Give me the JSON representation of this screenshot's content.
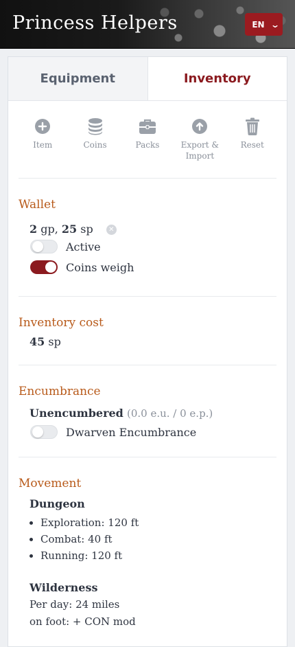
{
  "header": {
    "title": "Princess Helpers",
    "lang": "EN"
  },
  "tabs": [
    {
      "label": "Equipment",
      "active": false
    },
    {
      "label": "Inventory",
      "active": true
    }
  ],
  "toolbar": [
    {
      "label": "Item",
      "icon": "plus-circle-icon"
    },
    {
      "label": "Coins",
      "icon": "coins-icon"
    },
    {
      "label": "Packs",
      "icon": "backpack-icon"
    },
    {
      "label": "Export &\nImport",
      "icon": "upload-circle-icon"
    },
    {
      "label": "Reset",
      "icon": "trash-icon"
    }
  ],
  "wallet": {
    "title": "Wallet",
    "gp_value": "2",
    "gp_unit": "gp,",
    "sp_value": "25",
    "sp_unit": "sp",
    "active_label": "Active",
    "active_on": false,
    "coins_weigh_label": "Coins weigh",
    "coins_weigh_on": true
  },
  "inventory_cost": {
    "title": "Inventory cost",
    "value": "45",
    "unit": "sp"
  },
  "encumbrance": {
    "title": "Encumbrance",
    "status": "Unencumbered",
    "detail": "(0.0 e.u. / 0 e.p.)",
    "dwarven_label": "Dwarven Encumbrance",
    "dwarven_on": false
  },
  "movement": {
    "title": "Movement",
    "dungeon_heading": "Dungeon",
    "dungeon_items": [
      "Exploration: 120 ft",
      "Combat: 40 ft",
      "Running: 120 ft"
    ],
    "wilderness_heading": "Wilderness",
    "wilderness_line1": "Per day: 24 miles",
    "wilderness_line2": "on foot: + CON mod"
  },
  "colors": {
    "accent": "#8b1a1f",
    "section_title": "#b85a1a",
    "lang_button": "#9b1b20"
  }
}
